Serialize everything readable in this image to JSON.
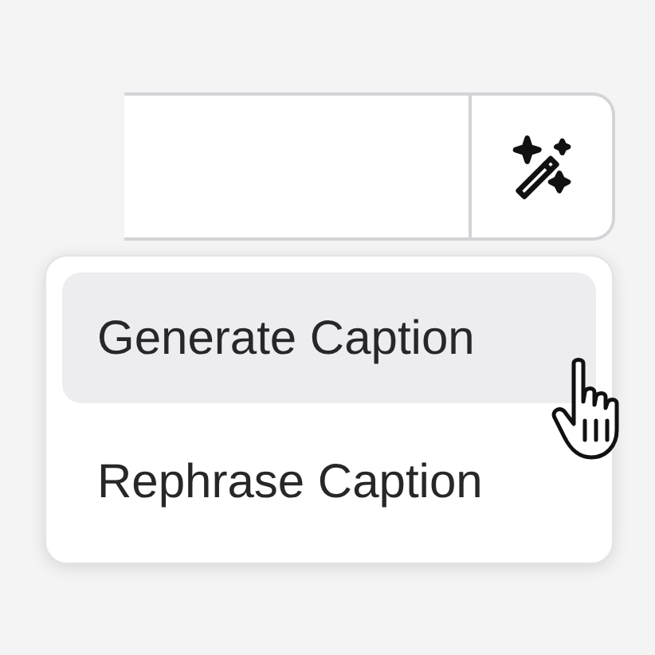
{
  "menu": {
    "items": [
      {
        "label": "Generate Caption",
        "selected": true
      },
      {
        "label": "Rephrase Caption",
        "selected": false
      }
    ]
  }
}
